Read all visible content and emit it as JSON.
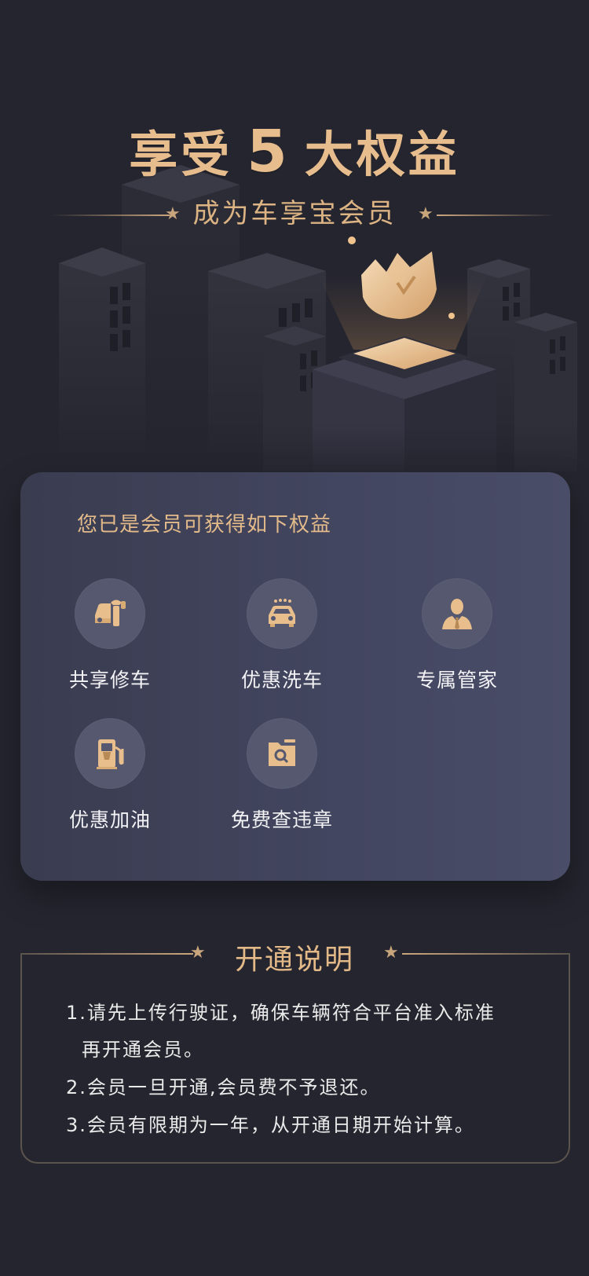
{
  "hero": {
    "title_left": "享受",
    "title_num": "5",
    "title_right": "大权益",
    "subtitle": "成为车享宝会员"
  },
  "card": {
    "heading": "您已是会员可获得如下权益",
    "benefits": [
      {
        "label": "共享修车",
        "icon": "car-repair-icon"
      },
      {
        "label": "优惠洗车",
        "icon": "car-wash-icon"
      },
      {
        "label": "专属管家",
        "icon": "butler-icon"
      },
      {
        "label": "优惠加油",
        "icon": "fuel-pump-icon"
      },
      {
        "label": "免费查违章",
        "icon": "violation-search-icon"
      }
    ]
  },
  "info": {
    "title": "开通说明",
    "lines": [
      "1.请先上传行驶证，确保车辆符合平台准入标准",
      "再开通会员。",
      "2.会员一旦开通,会员费不予退还。",
      "3.会员有限期为一年，从开通日期开始计算。"
    ]
  },
  "colors": {
    "background": "#25252f",
    "gold": "#e7bd8d",
    "card": "#434660",
    "icon_circle": "#55586f"
  }
}
